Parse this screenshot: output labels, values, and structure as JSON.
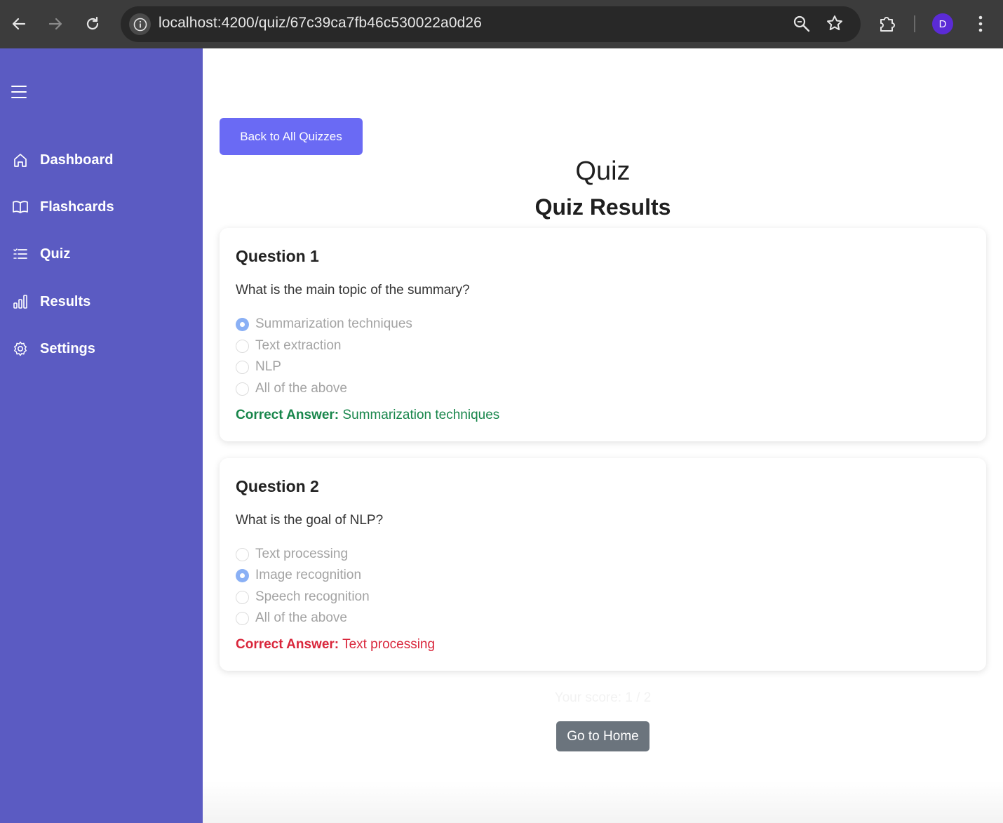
{
  "browser": {
    "url": "localhost:4200/quiz/67c39ca7fb46c530022a0d26",
    "profile_initial": "D"
  },
  "sidebar": {
    "items": [
      {
        "label": "Dashboard",
        "icon": "home-icon"
      },
      {
        "label": "Flashcards",
        "icon": "book-icon"
      },
      {
        "label": "Quiz",
        "icon": "list-icon"
      },
      {
        "label": "Results",
        "icon": "bar-chart-icon"
      },
      {
        "label": "Settings",
        "icon": "gear-icon"
      }
    ]
  },
  "main": {
    "back_button": "Back to All Quizzes",
    "title": "Quiz",
    "subtitle": "Quiz Results",
    "questions": [
      {
        "title": "Question 1",
        "text": "What is the main topic of the summary?",
        "options": [
          "Summarization techniques",
          "Text extraction",
          "NLP",
          "All of the above"
        ],
        "selected": "Summarization techniques",
        "correct_label": "Correct Answer:",
        "correct_answer": "Summarization techniques",
        "status": "correct"
      },
      {
        "title": "Question 2",
        "text": "What is the goal of NLP?",
        "options": [
          "Text processing",
          "Image recognition",
          "Speech recognition",
          "All of the above"
        ],
        "selected": "Image recognition",
        "correct_label": "Correct Answer:",
        "correct_answer": "Text processing",
        "status": "incorrect"
      }
    ],
    "score_text": "Your score: 1 / 2",
    "home_button": "Go to Home"
  },
  "colors": {
    "sidebar_bg": "#5b5bc2",
    "primary_button": "#6a6af4",
    "correct": "#18864b",
    "incorrect": "#d9263b",
    "home_button": "#6b747d"
  }
}
